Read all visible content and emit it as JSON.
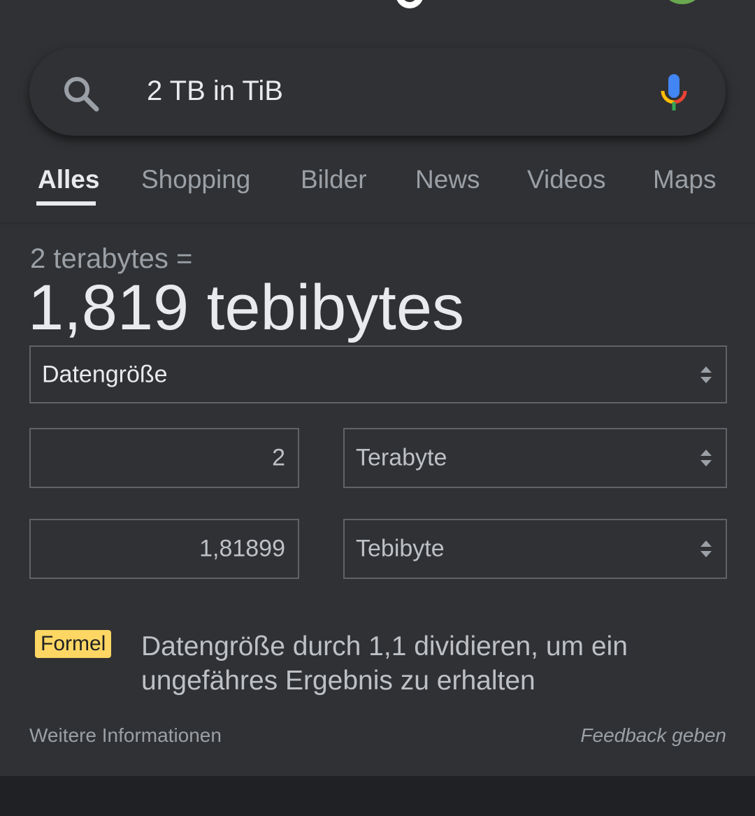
{
  "search": {
    "query": "2 TB in TiB"
  },
  "tabs": [
    {
      "label": "Alles",
      "active": true
    },
    {
      "label": "Shopping"
    },
    {
      "label": "Bilder"
    },
    {
      "label": "News"
    },
    {
      "label": "Videos"
    },
    {
      "label": "Maps"
    }
  ],
  "converter": {
    "equation_prefix": "2 terabytes =",
    "result": "1,819 tebibytes",
    "category": "Datengröße",
    "from_value": "2",
    "from_unit": "Terabyte",
    "to_value": "1,81899",
    "to_unit": "Tebibyte",
    "formula_badge": "Formel",
    "formula_text": "Datengröße durch 1,1 dividieren, um ein ungefähres Ergebnis zu erhalten",
    "more_info": "Weitere Informationen",
    "feedback": "Feedback geben"
  },
  "colors": {
    "badge": "#fdd663",
    "background": "#303134"
  }
}
